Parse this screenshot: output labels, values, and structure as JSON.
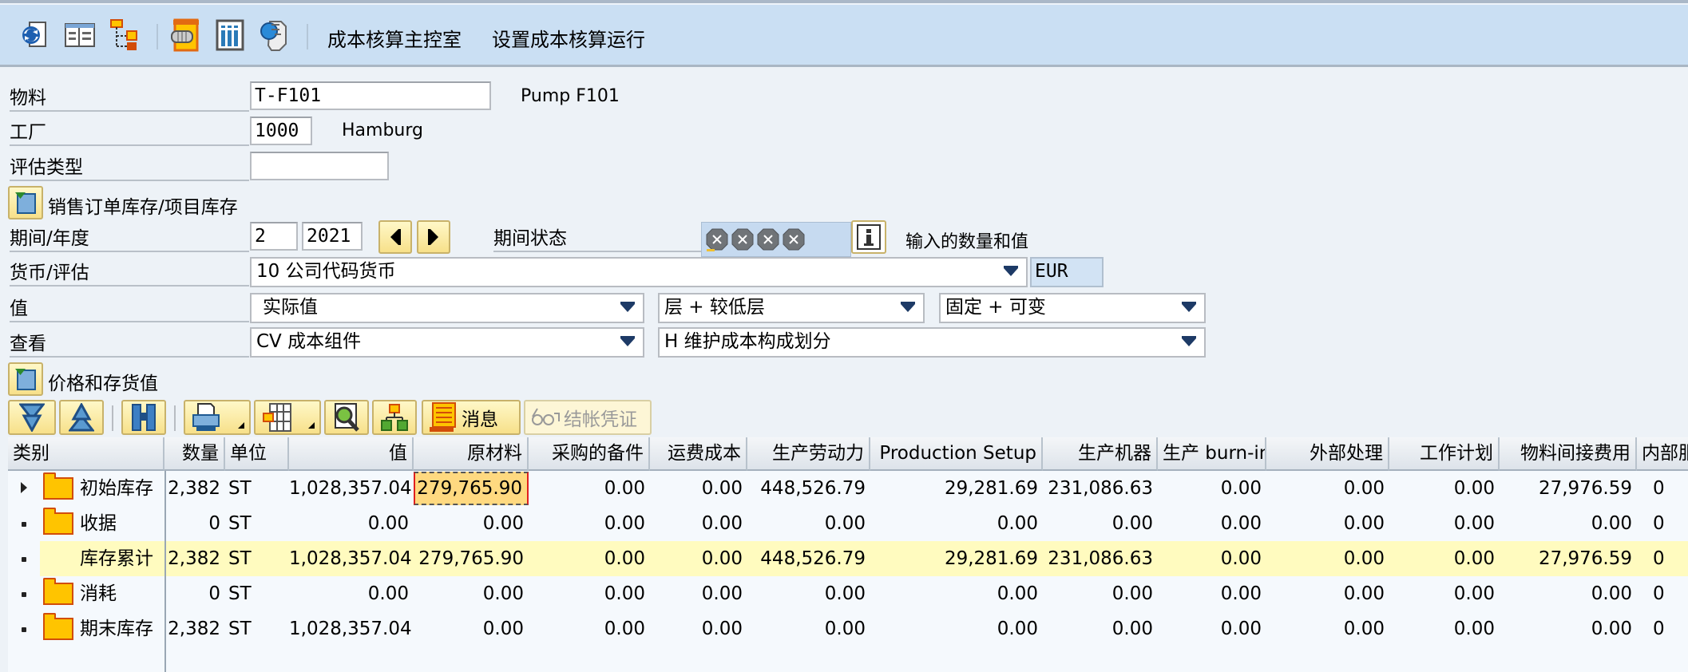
{
  "toolbar": {
    "icons": [
      "refresh-document-icon",
      "detail-view-icon",
      "hierarchy-icon",
      "settings-bolt-icon",
      "table-columns-icon",
      "search-glass-icon"
    ],
    "links": [
      "成本核算主控室",
      "设置成本核算运行"
    ]
  },
  "form": {
    "material": {
      "label": "物料",
      "value": "T-F101",
      "description": "Pump F101"
    },
    "plant": {
      "label": "工厂",
      "value": "1000",
      "description": "Hamburg"
    },
    "valuation_type": {
      "label": "评估类型",
      "value": ""
    },
    "sales_order_stock": {
      "label": "销售订单库存/项目库存"
    },
    "period_year": {
      "label": "期间/年度",
      "period": "2",
      "year": "2021"
    },
    "period_status": {
      "label": "期间状态",
      "status_icons": [
        "X",
        "X",
        "X",
        "X"
      ],
      "info_text": "输入的数量和值"
    },
    "currency": {
      "label": "货币/评估",
      "value": "10 公司代码货币",
      "currency_code": "EUR"
    },
    "values": {
      "label": "值",
      "value": "实际值",
      "level": "层 + 较低层",
      "fixed_variable": "固定 + 可变"
    },
    "view": {
      "label": "查看",
      "value": "CV 成本组件",
      "cost_split": "H 维护成本构成划分"
    }
  },
  "prices_section": {
    "label": "价格和存货值"
  },
  "grid_toolbar": {
    "messages_label": "消息",
    "closing_docs_label": "结帐凭证"
  },
  "table": {
    "columns": [
      "类别",
      "数量",
      "单位",
      "值",
      "原材料",
      "采购的备件",
      "运费成本",
      "生产劳动力",
      "Production Setup",
      "生产机器",
      "生产 burn-in",
      "外部处理",
      "工作计划",
      "物料间接费用",
      "内部服"
    ],
    "rows": [
      {
        "category": "初始库存",
        "folder": true,
        "expandable": true,
        "total": false,
        "cells": [
          "2,382",
          "ST",
          "1,028,357.04",
          "279,765.90",
          "0.00",
          "0.00",
          "448,526.79",
          "29,281.69",
          "231,086.63",
          "0.00",
          "0.00",
          "0.00",
          "27,976.59",
          "0"
        ]
      },
      {
        "category": "收据",
        "folder": true,
        "expandable": false,
        "total": false,
        "cells": [
          "0",
          "ST",
          "0.00",
          "0.00",
          "0.00",
          "0.00",
          "0.00",
          "0.00",
          "0.00",
          "0.00",
          "0.00",
          "0.00",
          "0.00",
          "0"
        ]
      },
      {
        "category": "库存累计",
        "folder": false,
        "expandable": false,
        "total": true,
        "cells": [
          "2,382",
          "ST",
          "1,028,357.04",
          "279,765.90",
          "0.00",
          "0.00",
          "448,526.79",
          "29,281.69",
          "231,086.63",
          "0.00",
          "0.00",
          "0.00",
          "27,976.59",
          "0"
        ]
      },
      {
        "category": "消耗",
        "folder": true,
        "expandable": false,
        "total": false,
        "cells": [
          "0",
          "ST",
          "0.00",
          "0.00",
          "0.00",
          "0.00",
          "0.00",
          "0.00",
          "0.00",
          "0.00",
          "0.00",
          "0.00",
          "0.00",
          "0"
        ]
      },
      {
        "category": "期末库存",
        "folder": true,
        "expandable": false,
        "total": false,
        "cells": [
          "2,382",
          "ST",
          "1,028,357.04",
          "0.00",
          "0.00",
          "0.00",
          "0.00",
          "0.00",
          "0.00",
          "0.00",
          "0.00",
          "0.00",
          "0.00",
          "0"
        ]
      }
    ],
    "selected_cell": {
      "row": 0,
      "column": "原材料"
    }
  }
}
